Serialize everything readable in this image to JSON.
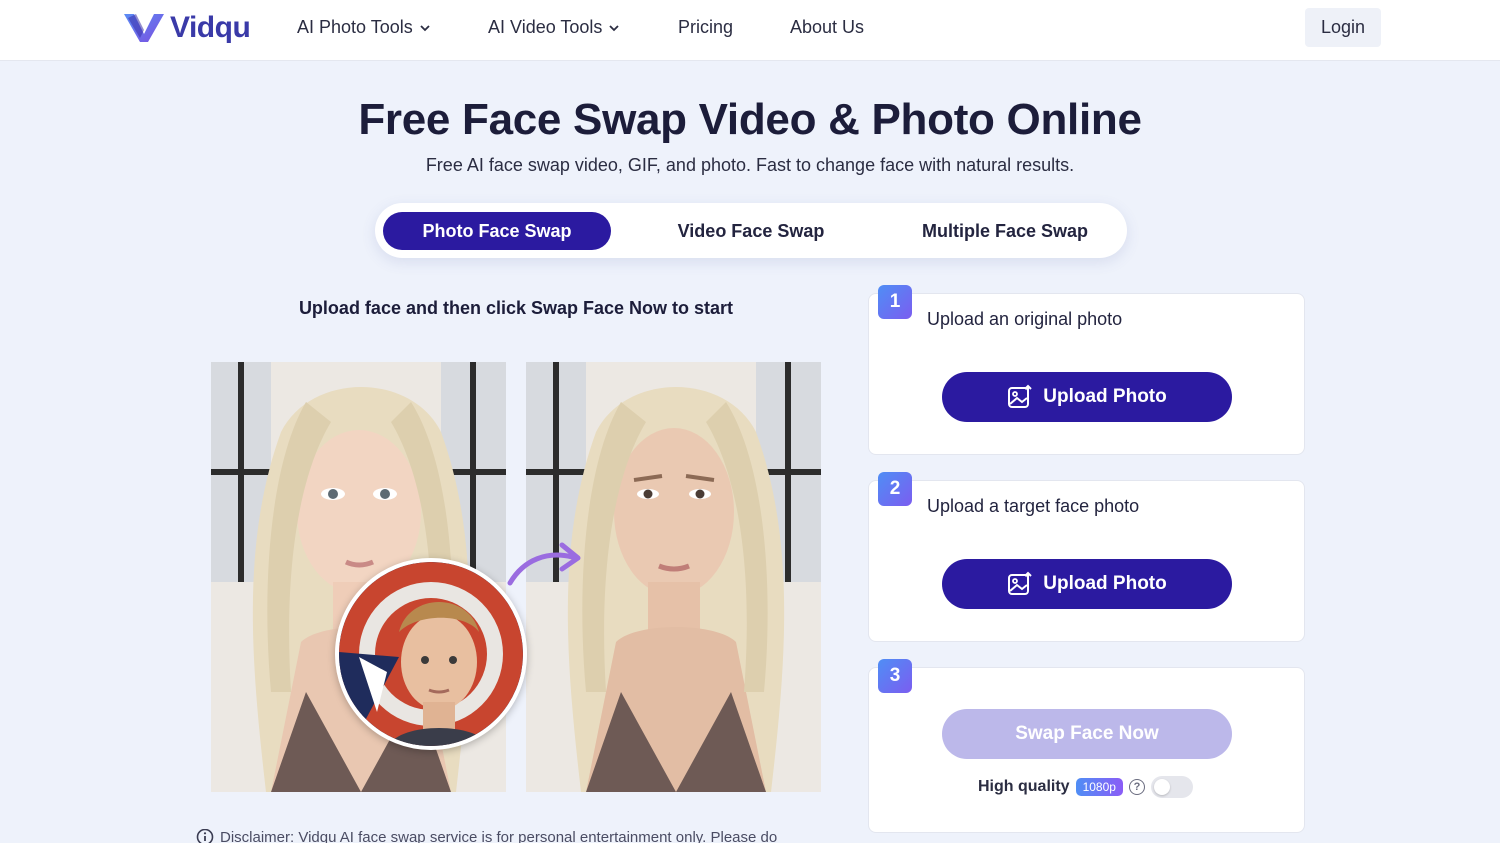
{
  "brand": {
    "name": "Vidqu"
  },
  "nav": {
    "items": [
      {
        "label": "AI Photo Tools",
        "has_dropdown": true
      },
      {
        "label": "AI Video Tools",
        "has_dropdown": true
      },
      {
        "label": "Pricing",
        "has_dropdown": false
      },
      {
        "label": "About Us",
        "has_dropdown": false
      }
    ],
    "login_label": "Login"
  },
  "hero": {
    "title": "Free Face Swap Video & Photo Online",
    "subtitle": "Free AI face swap video, GIF, and photo. Fast to change face with natural results."
  },
  "tabs": [
    {
      "label": "Photo Face Swap",
      "active": true
    },
    {
      "label": "Video Face Swap",
      "active": false
    },
    {
      "label": "Multiple Face Swap",
      "active": false
    }
  ],
  "instruction": "Upload face and then click Swap Face Now to start",
  "disclaimer": "Disclaimer: Vidqu AI face swap service is for personal entertainment only. Please do",
  "steps": [
    {
      "number": "1",
      "label": "Upload an original photo",
      "button": "Upload Photo"
    },
    {
      "number": "2",
      "label": "Upload a target face photo",
      "button": "Upload Photo"
    },
    {
      "number": "3",
      "label": "",
      "button": "Swap Face Now"
    }
  ],
  "quality": {
    "label": "High quality",
    "resolution": "1080p",
    "enabled": false
  },
  "colors": {
    "primary": "#2b1aa0",
    "disabled": "#bcb8ea",
    "page_bg": "#eef2fb",
    "accent_gradient_start": "#4f8ef5",
    "accent_gradient_end": "#7b5df0"
  }
}
